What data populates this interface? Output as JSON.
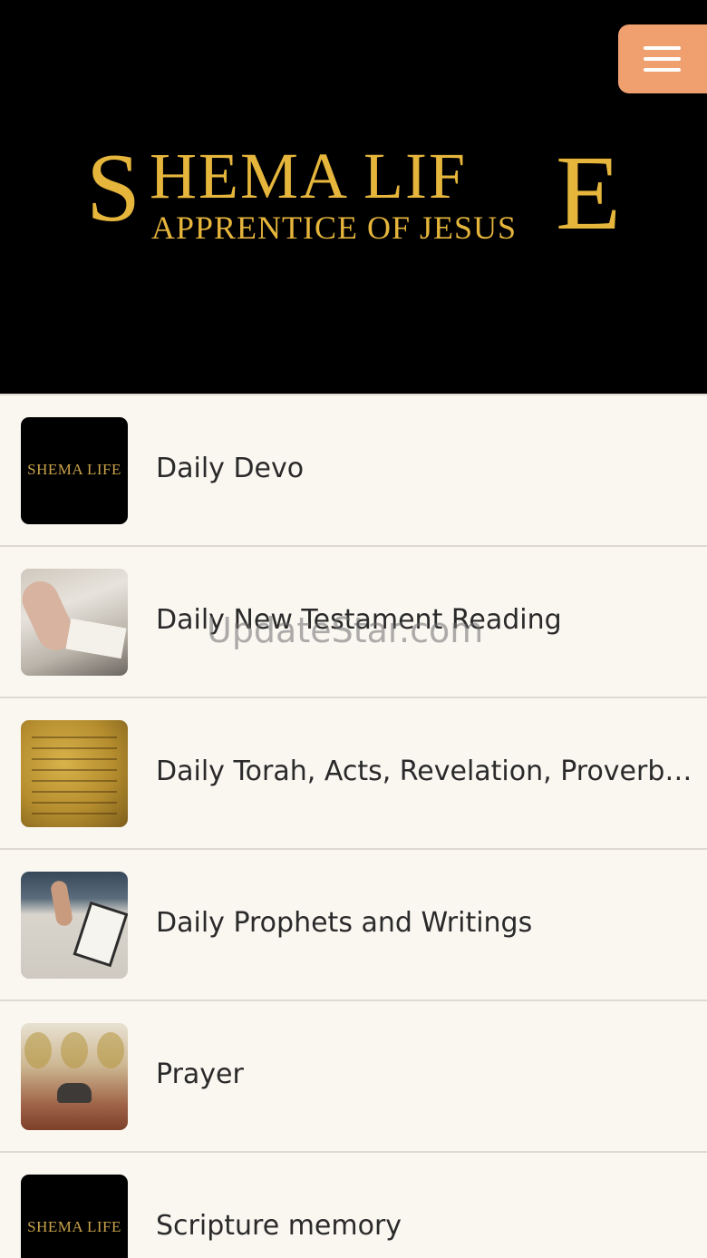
{
  "header": {
    "logo_line1_s": "S",
    "logo_line1_middle": "HEMA LIF",
    "logo_line1_e": "E",
    "logo_line2": "APPRENTICE OF JESUS",
    "logo_alt": "SHEMA LIFE APPRENTICE OF JESUS",
    "menu_icon": "hamburger-menu-icon",
    "menu_color": "#f0a06f",
    "logo_color": "#e5b53c"
  },
  "list": {
    "items": [
      {
        "label": "Daily Devo",
        "thumb": "shema-life-logo",
        "thumb_text": "SHEMA LIFE"
      },
      {
        "label": "Daily New Testament Reading",
        "thumb": "bible-reading-photo"
      },
      {
        "label": "Daily Torah, Acts, Revelation, Proverbs and ...",
        "thumb": "ancient-scroll-photo"
      },
      {
        "label": "Daily Prophets and Writings",
        "thumb": "writing-with-bible-photo"
      },
      {
        "label": "Prayer",
        "thumb": "kneeling-prayer-photo"
      },
      {
        "label": "Scripture memory",
        "thumb": "shema-life-logo",
        "thumb_text": "SHEMA LIFE"
      }
    ]
  },
  "watermark": "UpdateStar.com"
}
